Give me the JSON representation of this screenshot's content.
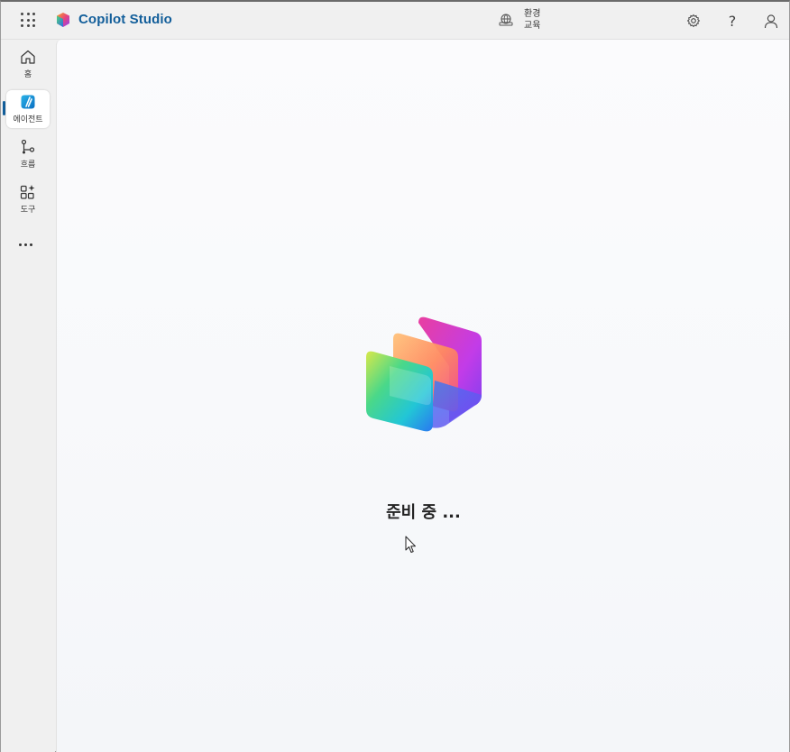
{
  "app": {
    "name": "Copilot Studio"
  },
  "header": {
    "environment_label": "환경",
    "environment_value": "교육",
    "help_glyph": "?",
    "icons": [
      "app-launcher-icon",
      "environment-icon",
      "settings-icon",
      "help-icon",
      "account-icon"
    ]
  },
  "sidebar": {
    "items": [
      {
        "label": "홈",
        "icon": "home-icon",
        "active": false
      },
      {
        "label": "에이전트",
        "icon": "agents-icon",
        "active": true
      },
      {
        "label": "흐름",
        "icon": "flows-icon",
        "active": false
      },
      {
        "label": "도구",
        "icon": "tools-icon",
        "active": false
      }
    ],
    "more_icon": "more-icon"
  },
  "main": {
    "loading_text": "준비 중 ..."
  },
  "colors": {
    "brand": "#125e9a",
    "background": "#f0f0f0",
    "canvas": "#f8f9fb"
  }
}
